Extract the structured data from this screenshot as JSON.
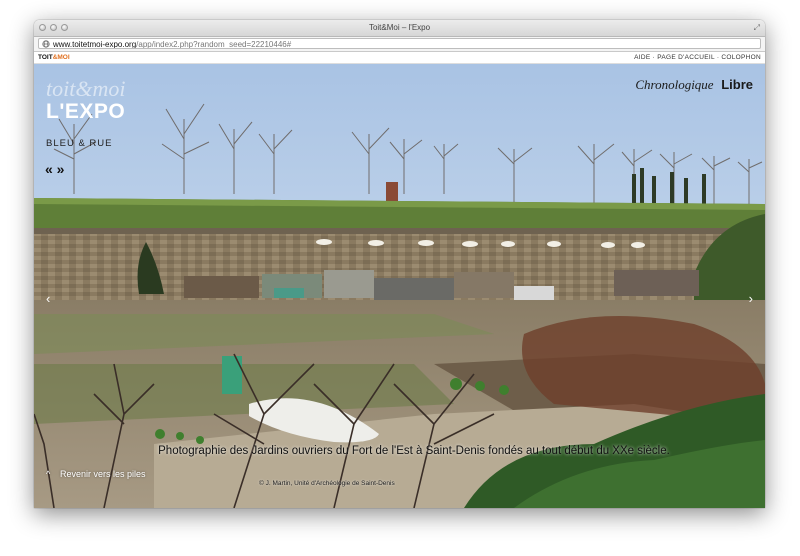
{
  "window": {
    "title": "Toit&Moi – l'Expo"
  },
  "url": {
    "host": "www.toitetmoi-expo.org",
    "path": "/app/index2.php?random_seed=22210446#"
  },
  "site": {
    "logo_a": "TOIT",
    "logo_b": "&MOI",
    "nav": [
      "AIDE",
      "·",
      "PAGE D'ACCUEIL",
      "·",
      "COLOPHON"
    ]
  },
  "expo": {
    "brand": "toit&moi",
    "title": "L'EXPO",
    "subtitle": "BLEU & RUE",
    "arrows": "« »"
  },
  "modes": {
    "chronologique": "Chronologique",
    "libre": "Libre"
  },
  "nav_arrows": {
    "prev": "‹",
    "next": "›"
  },
  "caption": {
    "text": "Photographie des Jardins ouvriers du Fort de l'Est à Saint-Denis fondés au tout début du XXe siècle.",
    "credit": "© J. Martin, Unité d'Archéologie de Saint-Denis"
  },
  "back": {
    "chevron": "^",
    "label": "Revenir vers les piles"
  },
  "colors": {
    "accent": "#e07020",
    "sky": "#b8cfe6",
    "grass": "#5f7f38"
  }
}
